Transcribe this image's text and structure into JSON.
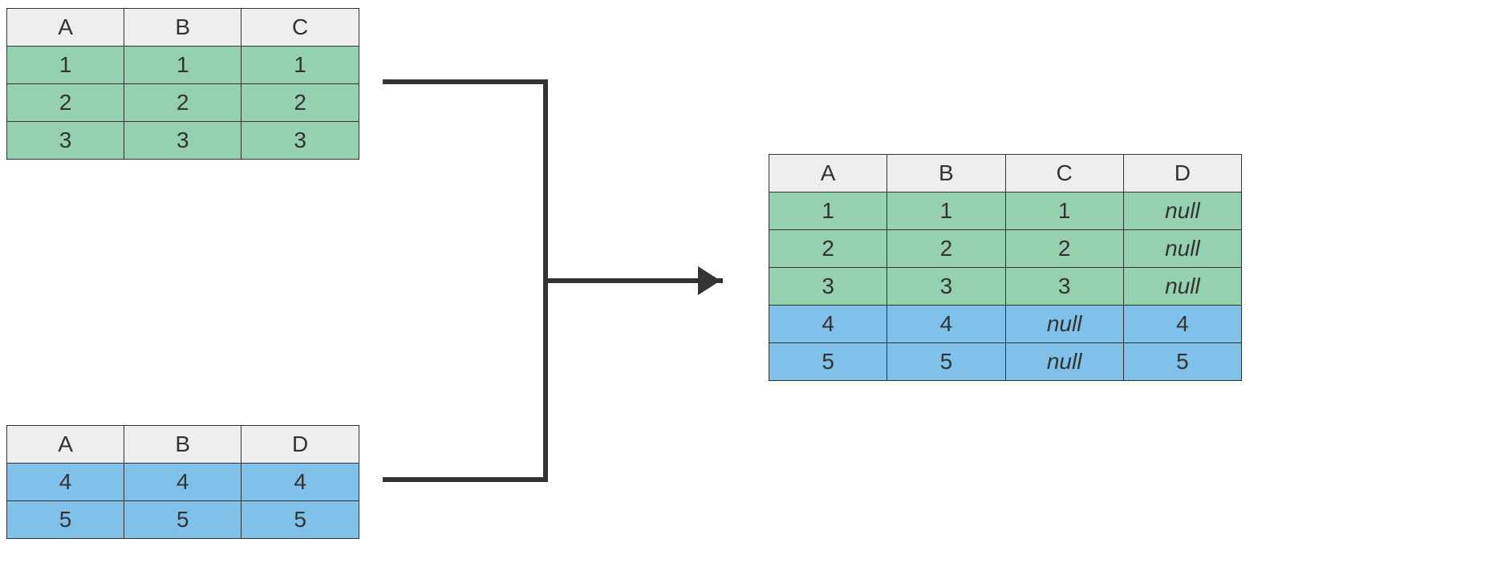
{
  "table1": {
    "headers": [
      "A",
      "B",
      "C"
    ],
    "rows": [
      [
        "1",
        "1",
        "1"
      ],
      [
        "2",
        "2",
        "2"
      ],
      [
        "3",
        "3",
        "3"
      ]
    ],
    "rowClass": "green"
  },
  "table2": {
    "headers": [
      "A",
      "B",
      "D"
    ],
    "rows": [
      [
        "4",
        "4",
        "4"
      ],
      [
        "5",
        "5",
        "5"
      ]
    ],
    "rowClass": "blue"
  },
  "result": {
    "headers": [
      "A",
      "B",
      "C",
      "D"
    ],
    "rows": [
      {
        "cells": [
          "1",
          "1",
          "1",
          "null"
        ],
        "class": "green"
      },
      {
        "cells": [
          "2",
          "2",
          "2",
          "null"
        ],
        "class": "green"
      },
      {
        "cells": [
          "3",
          "3",
          "3",
          "null"
        ],
        "class": "green"
      },
      {
        "cells": [
          "4",
          "4",
          "null",
          "4"
        ],
        "class": "blue"
      },
      {
        "cells": [
          "5",
          "5",
          "null",
          "5"
        ],
        "class": "blue"
      }
    ]
  },
  "nullText": "null",
  "colors": {
    "header": "#eeeeee",
    "green": "#96d1af",
    "blue": "#7fc1e8",
    "border": "#333333"
  }
}
